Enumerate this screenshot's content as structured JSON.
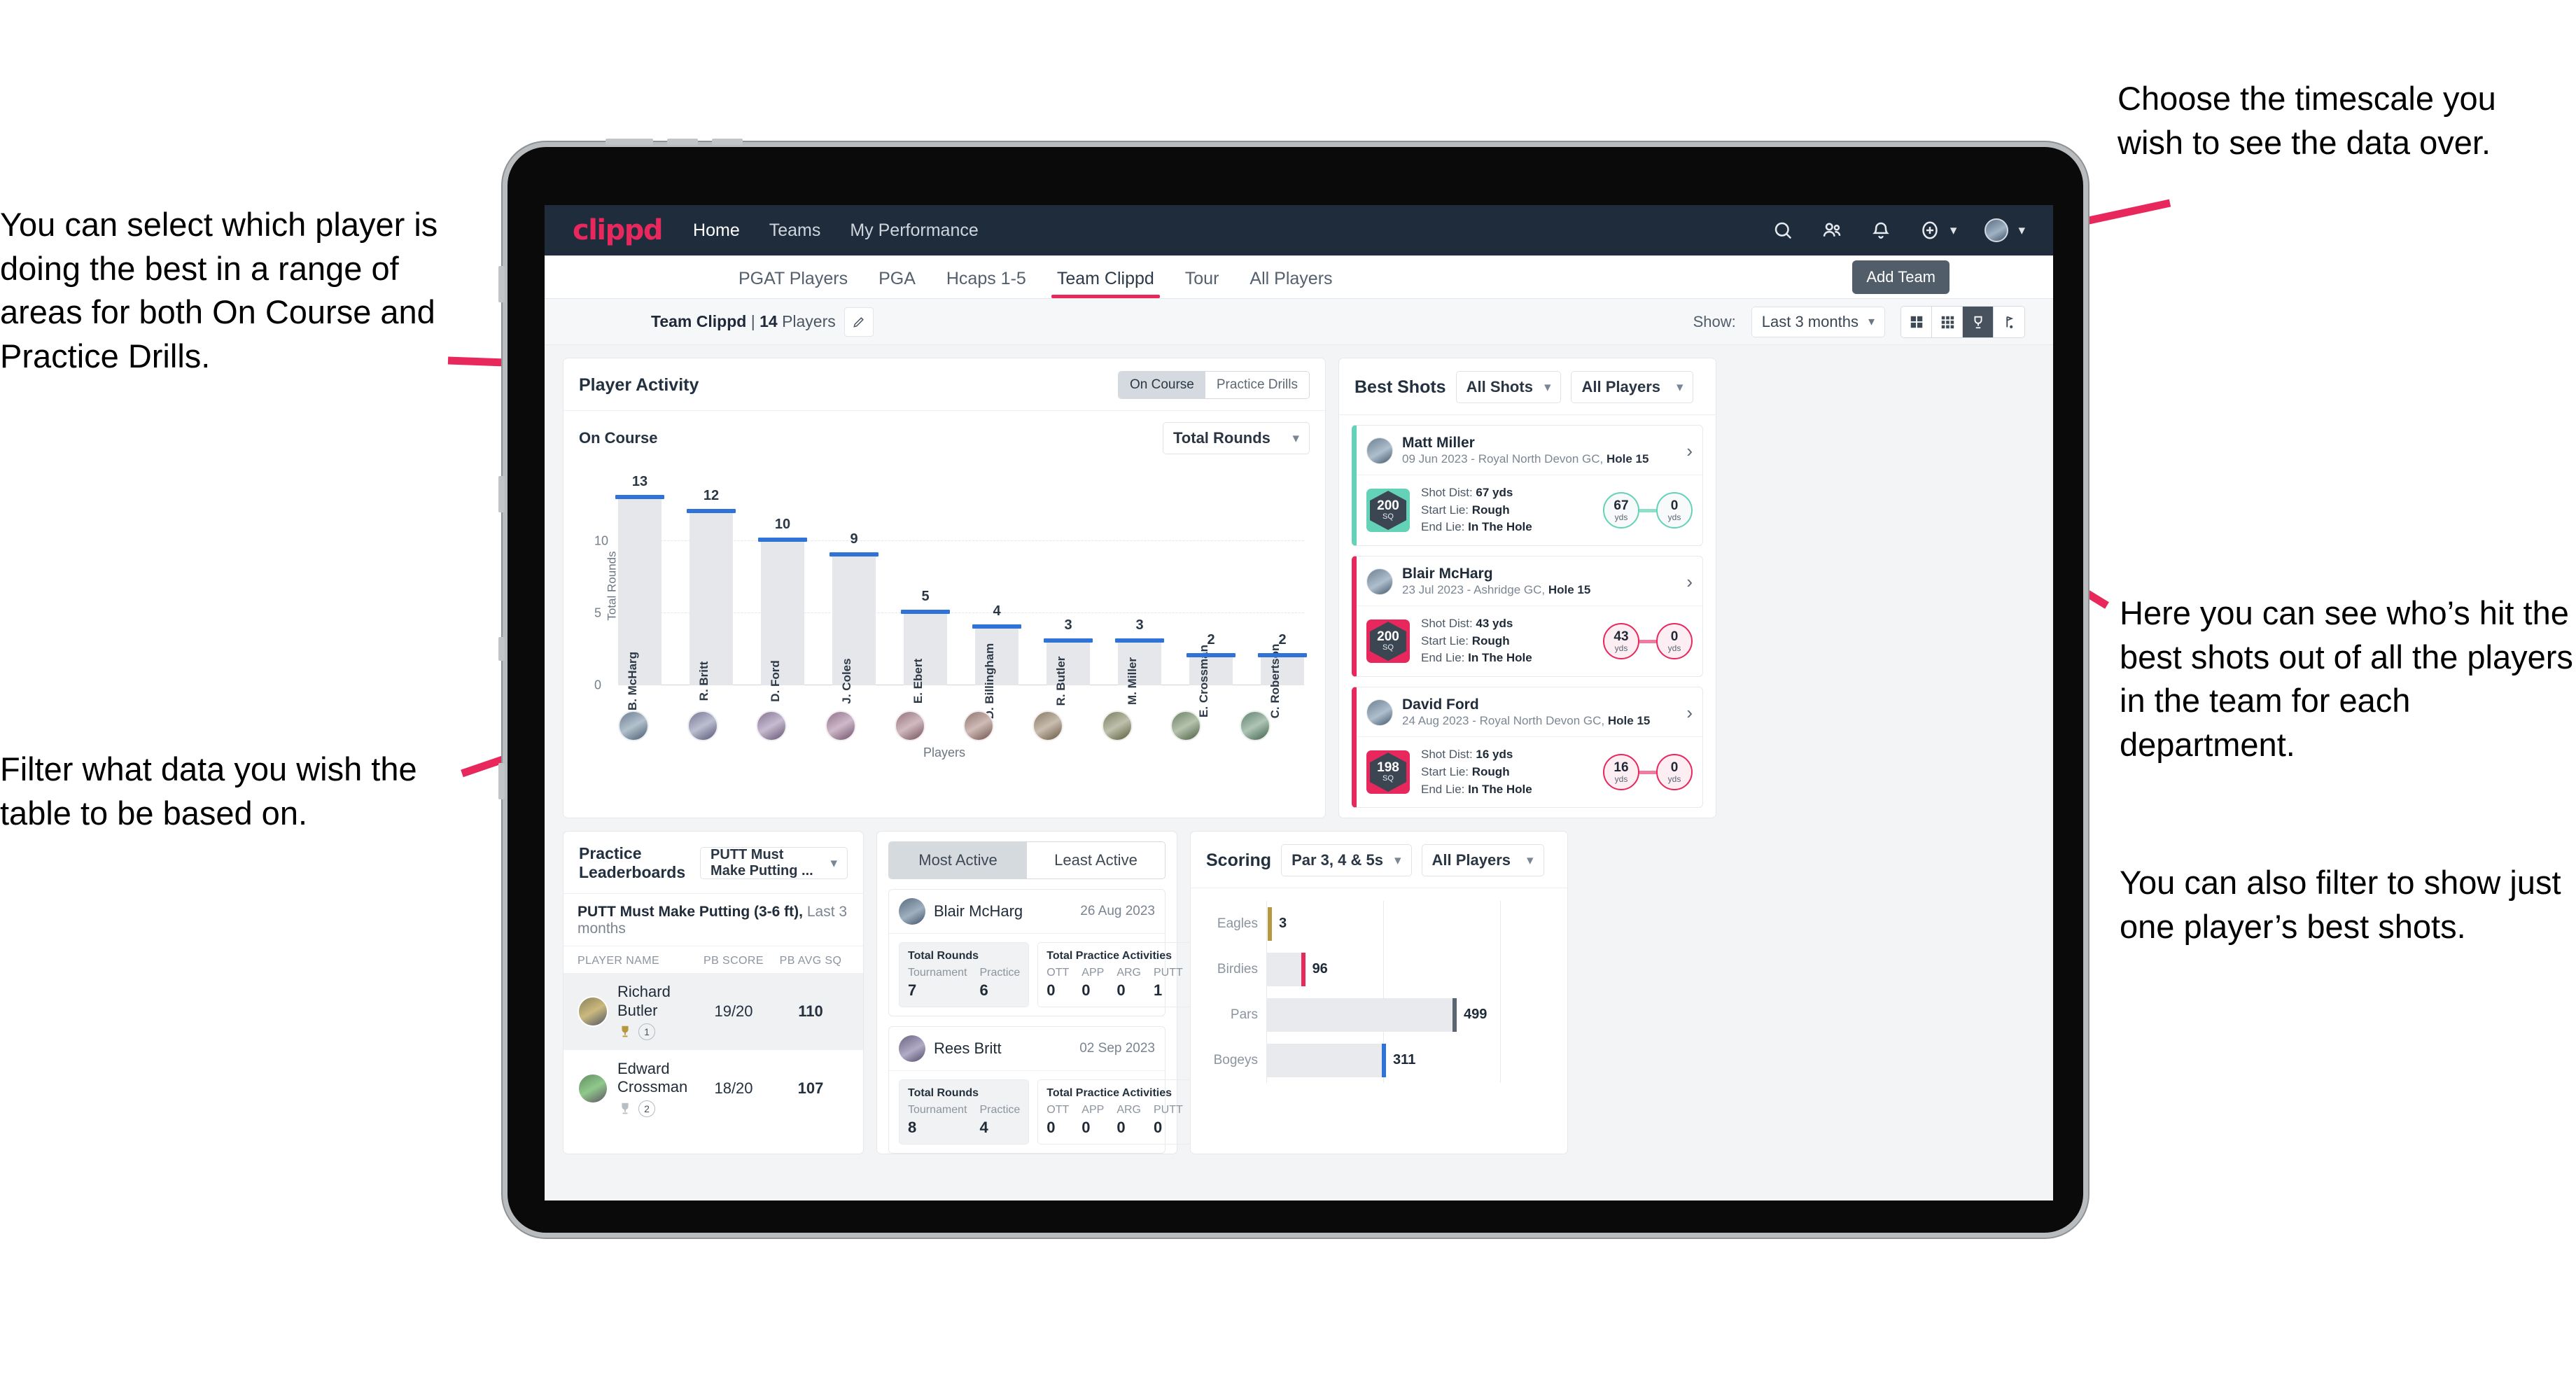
{
  "annotations": {
    "left_top": "You can select which player is doing the best in a range of areas for both On Course and Practice Drills.",
    "left_bottom": "Filter what data you wish the table to be based on.",
    "right_top": "Choose the timescale you wish to see the data over.",
    "right_middle": "Here you can see who’s hit the best shots out of all the players in the team for each department.",
    "right_bottom": "You can also filter to show just one player’s best shots."
  },
  "navbar": {
    "brand": "clippd",
    "links": [
      {
        "label": "Home",
        "active": true
      },
      {
        "label": "Teams",
        "active": false
      },
      {
        "label": "My Performance",
        "active": false
      }
    ],
    "icons": [
      "search-icon",
      "people-icon",
      "bell-icon",
      "plus-circle-icon",
      "profile-avatar"
    ]
  },
  "tabs": [
    {
      "label": "PGAT Players",
      "active": false
    },
    {
      "label": "PGA",
      "active": false
    },
    {
      "label": "Hcaps 1-5",
      "active": false
    },
    {
      "label": "Team Clippd",
      "active": true
    },
    {
      "label": "Tour",
      "active": false
    },
    {
      "label": "All Players",
      "active": false
    }
  ],
  "tooltip": {
    "add_team": "Add Team"
  },
  "subheader": {
    "team_name": "Team Clippd",
    "separator": "|",
    "player_count": "14",
    "players_word": "Players",
    "edit_icon": "pencil-icon",
    "show_label": "Show:",
    "timescale_value": "Last 3 months",
    "view_toggles": [
      {
        "icon": "grid-large-icon",
        "active": false
      },
      {
        "icon": "grid-small-icon",
        "active": false
      },
      {
        "icon": "trophy-icon",
        "active": true
      },
      {
        "icon": "golf-flag-icon",
        "active": false
      }
    ]
  },
  "player_activity": {
    "title": "Player Activity",
    "segments": [
      {
        "label": "On Course",
        "active": true
      },
      {
        "label": "Practice Drills",
        "active": false
      }
    ],
    "sub_title": "On Course",
    "metric_select": "Total Rounds",
    "x_axis_label": "Players",
    "avatar_count": 10
  },
  "best_shots": {
    "title": "Best Shots",
    "filter_shots": "All Shots",
    "filter_players": "All Players",
    "shots": [
      {
        "player": "Matt Miller",
        "meta_date": "09 Jun 2023 - Royal North Devon GC,",
        "meta_hole": "Hole 15",
        "sq": "200",
        "sq_unit": "SQ",
        "accent": "teal",
        "shot_dist_label": "Shot Dist:",
        "shot_dist": "67 yds",
        "start_lie_label": "Start Lie:",
        "start_lie": "Rough",
        "end_lie_label": "End Lie:",
        "end_lie": "In The Hole",
        "from_value": "67",
        "from_unit": "yds",
        "to_value": "0",
        "to_unit": "yds"
      },
      {
        "player": "Blair McHarg",
        "meta_date": "23 Jul 2023 - Ashridge GC,",
        "meta_hole": "Hole 15",
        "sq": "200",
        "sq_unit": "SQ",
        "accent": "pink",
        "shot_dist_label": "Shot Dist:",
        "shot_dist": "43 yds",
        "start_lie_label": "Start Lie:",
        "start_lie": "Rough",
        "end_lie_label": "End Lie:",
        "end_lie": "In The Hole",
        "from_value": "43",
        "from_unit": "yds",
        "to_value": "0",
        "to_unit": "yds"
      },
      {
        "player": "David Ford",
        "meta_date": "24 Aug 2023 - Royal North Devon GC,",
        "meta_hole": "Hole 15",
        "sq": "198",
        "sq_unit": "SQ",
        "accent": "pink",
        "shot_dist_label": "Shot Dist:",
        "shot_dist": "16 yds",
        "start_lie_label": "Start Lie:",
        "start_lie": "Rough",
        "end_lie_label": "End Lie:",
        "end_lie": "In The Hole",
        "from_value": "16",
        "from_unit": "yds",
        "to_value": "0",
        "to_unit": "yds"
      }
    ]
  },
  "practice_leaderboards": {
    "title": "Practice Leaderboards",
    "drill_select": "PUTT Must Make Putting ...",
    "subtitle_bold": "PUTT Must Make Putting (3-6 ft),",
    "subtitle_rest": "Last 3 months",
    "columns": [
      "PLAYER NAME",
      "PB SCORE",
      "PB AVG SQ"
    ],
    "rows": [
      {
        "name": "Richard Butler",
        "rank": "1",
        "trophy": "gold",
        "pb_score": "19/20",
        "pb_avg_sq": "110"
      },
      {
        "name": "Edward Crossman",
        "rank": "2",
        "trophy": "silver",
        "pb_score": "18/20",
        "pb_avg_sq": "107"
      }
    ]
  },
  "activity_panel": {
    "tabs": [
      {
        "label": "Most Active",
        "active": true
      },
      {
        "label": "Least Active",
        "active": false
      }
    ],
    "items": [
      {
        "name": "Blair McHarg",
        "date": "26 Aug 2023",
        "rounds_title": "Total Rounds",
        "rounds": [
          {
            "label": "Tournament",
            "value": "7"
          },
          {
            "label": "Practice",
            "value": "6"
          }
        ],
        "practice_title": "Total Practice Activities",
        "practice": [
          {
            "label": "OTT",
            "value": "0"
          },
          {
            "label": "APP",
            "value": "0"
          },
          {
            "label": "ARG",
            "value": "0"
          },
          {
            "label": "PUTT",
            "value": "1"
          }
        ]
      },
      {
        "name": "Rees Britt",
        "date": "02 Sep 2023",
        "rounds_title": "Total Rounds",
        "rounds": [
          {
            "label": "Tournament",
            "value": "8"
          },
          {
            "label": "Practice",
            "value": "4"
          }
        ],
        "practice_title": "Total Practice Activities",
        "practice": [
          {
            "label": "OTT",
            "value": "0"
          },
          {
            "label": "APP",
            "value": "0"
          },
          {
            "label": "ARG",
            "value": "0"
          },
          {
            "label": "PUTT",
            "value": "0"
          }
        ]
      }
    ]
  },
  "scoring": {
    "title": "Scoring",
    "filter_par": "Par 3, 4 & 5s",
    "filter_players": "All Players"
  },
  "colors": {
    "brand_pink": "#e8285d",
    "nav_dark": "#1e2c3c",
    "bar_blue": "#2f72d8",
    "teal": "#63d2b6",
    "gold": "#b8973f"
  },
  "chart_data": [
    {
      "type": "bar",
      "title": "Player Activity — On Course",
      "xlabel": "Players",
      "ylabel": "Total Rounds",
      "ylim": [
        0,
        14
      ],
      "yticks": [
        0,
        5,
        10
      ],
      "grid": true,
      "categories": [
        "B. McHarg",
        "R. Britt",
        "D. Ford",
        "J. Coles",
        "E. Ebert",
        "D. Billingham",
        "R. Butler",
        "M. Miller",
        "E. Crossman",
        "C. Robertson"
      ],
      "values": [
        13,
        12,
        10,
        9,
        5,
        4,
        3,
        3,
        2,
        2
      ]
    },
    {
      "type": "bar",
      "orientation": "horizontal",
      "title": "Scoring",
      "xlabel": "",
      "ylabel": "",
      "xlim": [
        0,
        700
      ],
      "grid": true,
      "categories": [
        "Eagles",
        "Birdies",
        "Pars",
        "Bogeys"
      ],
      "values": [
        3,
        96,
        499,
        311
      ],
      "cap_colors": [
        "#b8973f",
        "#e8285d",
        "#5b6572",
        "#2f72d8"
      ]
    }
  ]
}
